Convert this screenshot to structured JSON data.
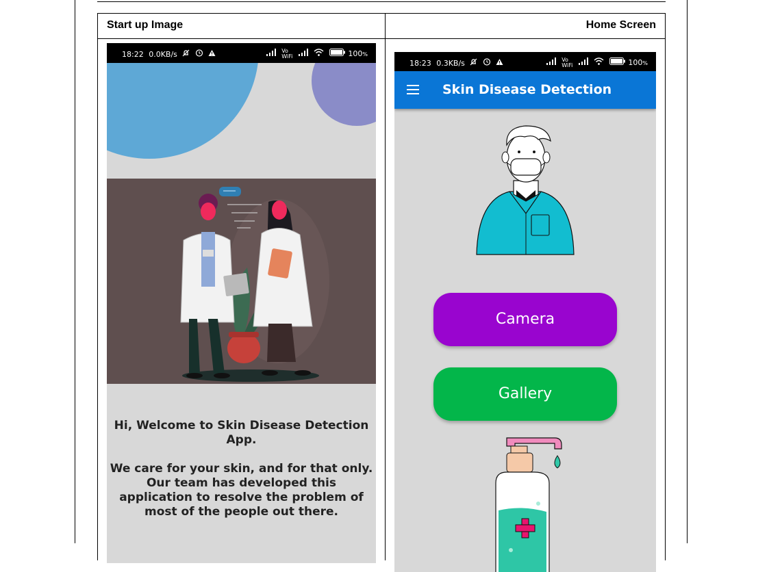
{
  "table": {
    "col1_header": "Start up Image",
    "col2_header": "Home Screen"
  },
  "startup_screen": {
    "status": {
      "time": "18:22",
      "speed": "0.0KB/s",
      "battery": "100"
    },
    "welcome_line1": "Hi, Welcome to Skin Disease Detection",
    "welcome_line2": "App.",
    "body_line1": "We care for your skin, and for that only.",
    "body_line2": "Our team has developed this",
    "body_line3": "application to resolve the problem of",
    "body_line4": "most of the people out there.",
    "colors": {
      "circle_blue": "#5ea8d6",
      "circle_purple": "#8a8cc8",
      "scene_bg": "#5f4f4f"
    }
  },
  "home_screen": {
    "status": {
      "time": "18:23",
      "speed": "0.3KB/s",
      "battery": "100"
    },
    "app_title": "Skin Disease Detection",
    "camera_label": "Camera",
    "gallery_label": "Gallery",
    "colors": {
      "appbar": "#0a76d6",
      "camera_button": "#9905cf",
      "gallery_button": "#03b64a",
      "shirt": "#12bdd0"
    },
    "icons": [
      "menu-icon",
      "doctor-illustration",
      "sanitizer-illustration"
    ]
  }
}
